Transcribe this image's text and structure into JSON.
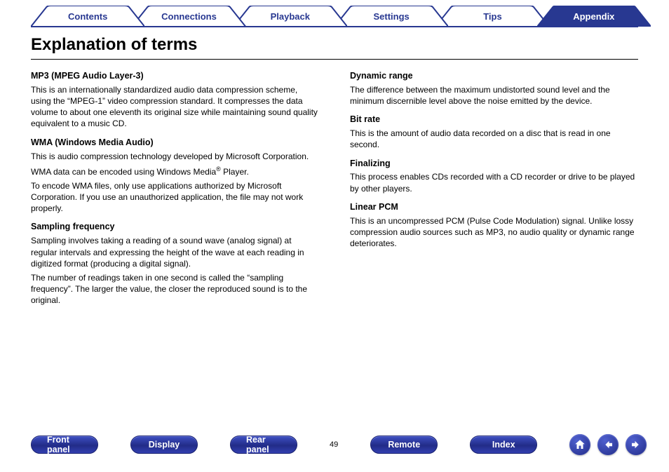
{
  "tabs": [
    {
      "label": "Contents",
      "active": false
    },
    {
      "label": "Connections",
      "active": false
    },
    {
      "label": "Playback",
      "active": false
    },
    {
      "label": "Settings",
      "active": false
    },
    {
      "label": "Tips",
      "active": false
    },
    {
      "label": "Appendix",
      "active": true
    }
  ],
  "heading": "Explanation of terms",
  "left_col": [
    {
      "title": "MP3 (MPEG Audio Layer-3)",
      "paras": [
        "This is an internationally standardized audio data compression scheme, using the “MPEG-1” video compression standard. It compresses the data volume to about one eleventh its original size while maintaining sound quality equivalent to a music CD."
      ]
    },
    {
      "title": "WMA (Windows Media Audio)",
      "paras": [
        "This is audio compression technology developed by Microsoft Corporation.",
        "WMA data can be encoded using Windows Media® Player.",
        "To encode WMA files, only use applications authorized by Microsoft Corporation. If you use an unauthorized application, the file may not work properly."
      ]
    },
    {
      "title": "Sampling frequency",
      "paras": [
        "Sampling involves taking a reading of a sound wave (analog signal) at regular intervals and expressing the height of the wave at each reading in digitized format (producing a digital signal).",
        "The number of readings taken in one second is called the “sampling frequency”. The larger the value, the closer the reproduced sound is to the original."
      ]
    }
  ],
  "right_col": [
    {
      "title": "Dynamic range",
      "paras": [
        "The difference between the maximum undistorted sound level and the minimum discernible level above the noise emitted by the device."
      ]
    },
    {
      "title": "Bit rate",
      "paras": [
        "This is the amount of audio data recorded on a disc that is read in one second."
      ]
    },
    {
      "title": "Finalizing",
      "paras": [
        "This process enables CDs recorded with a CD recorder or drive to be played by other players."
      ]
    },
    {
      "title": "Linear PCM",
      "paras": [
        "This is an uncompressed PCM (Pulse Code Modulation) signal. Unlike lossy compression audio sources such as MP3, no audio quality or dynamic range deteriorates."
      ]
    }
  ],
  "bottom": {
    "pills_left": [
      "Front panel",
      "Display",
      "Rear panel"
    ],
    "page": "49",
    "pills_right": [
      "Remote",
      "Index"
    ]
  },
  "icons": {
    "home": "home-icon",
    "back": "arrow-left-icon",
    "fwd": "arrow-right-icon"
  }
}
